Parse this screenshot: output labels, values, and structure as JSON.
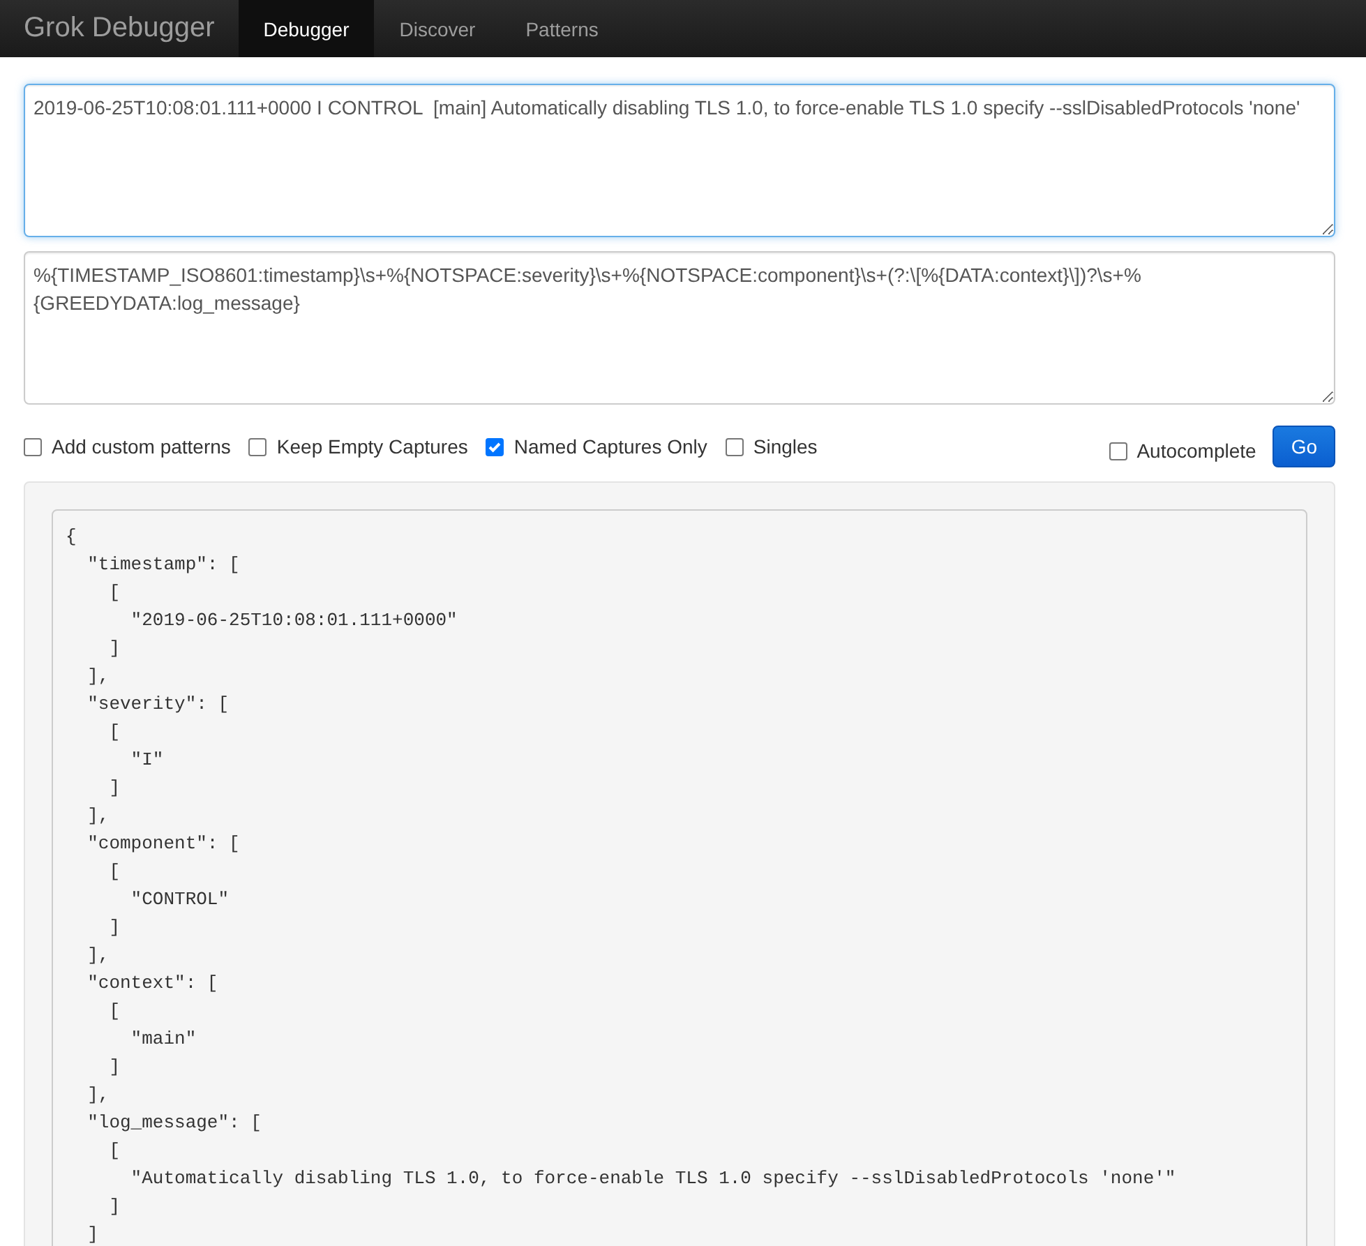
{
  "navbar": {
    "brand": "Grok Debugger",
    "tabs": [
      {
        "label": "Debugger",
        "selected": true
      },
      {
        "label": "Discover",
        "selected": false
      },
      {
        "label": "Patterns",
        "selected": false
      }
    ]
  },
  "input": {
    "value": "2019-06-25T10:08:01.111+0000 I CONTROL  [main] Automatically disabling TLS 1.0, to force-enable TLS 1.0 specify --sslDisabledProtocols 'none'",
    "focused": true
  },
  "pattern": {
    "value": "%{TIMESTAMP_ISO8601:timestamp}\\s+%{NOTSPACE:severity}\\s+%{NOTSPACE:component}\\s+(?:\\[%{DATA:context}\\])?\\s+%{GREEDYDATA:log_message}",
    "focused": false
  },
  "options": [
    {
      "label": "Add custom patterns",
      "checked": false
    },
    {
      "label": "Keep Empty Captures",
      "checked": false
    },
    {
      "label": "Named Captures Only",
      "checked": true
    },
    {
      "label": "Singles",
      "checked": false
    }
  ],
  "autocomplete": {
    "label": "Autocomplete",
    "checked": false
  },
  "go_button": "Go",
  "output": {
    "lines": [
      "{",
      "  \"timestamp\": [",
      "    [",
      "      \"2019-06-25T10:08:01.111+0000\"",
      "    ]",
      "  ],",
      "  \"severity\": [",
      "    [",
      "      \"I\"",
      "    ]",
      "  ],",
      "  \"component\": [",
      "    [",
      "      \"CONTROL\"",
      "    ]",
      "  ],",
      "  \"context\": [",
      "    [",
      "      \"main\"",
      "    ]",
      "  ],",
      "  \"log_message\": [",
      "    [",
      "      \"Automatically disabling TLS 1.0, to force-enable TLS 1.0 specify --sslDisabledProtocols 'none'\"",
      "    ]",
      "  ]"
    ]
  }
}
